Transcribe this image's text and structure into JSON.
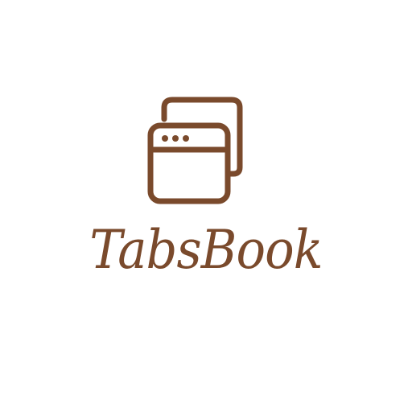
{
  "logo": {
    "icon": "browser-tabs-icon",
    "wordmark": "TabsBook",
    "color": "#7a4a2c"
  },
  "background": "#ffffff"
}
